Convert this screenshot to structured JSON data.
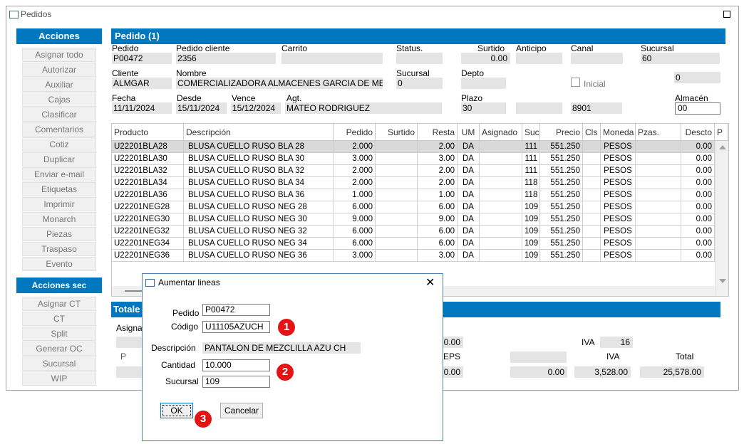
{
  "window": {
    "title": "Pedidos"
  },
  "acciones": {
    "title": "Acciones",
    "items": [
      "Asignar todo",
      "Autorizar",
      "Auxiliar",
      "Cajas",
      "Clasificar",
      "Comentarios",
      "Cotiz",
      "Duplicar",
      "Enviar e-mail",
      "Etiquetas",
      "Imprimir",
      "Monarch",
      "Piezas",
      "Traspaso",
      "Evento"
    ]
  },
  "acciones_sec": {
    "title": "Acciones sec",
    "items": [
      "Asignar CT",
      "CT",
      "Split",
      "Generar OC",
      "Sucursal",
      "WIP"
    ]
  },
  "pedido": {
    "title": "Pedido (1)",
    "labels": {
      "pedido": "Pedido",
      "pedido_cliente": "Pedido cliente",
      "carrito": "Carrito",
      "status": "Status.",
      "surtido": "Surtido",
      "anticipo": "Anticipo",
      "canal": "Canal",
      "sucursal": "Sucursal",
      "cliente": "Cliente",
      "nombre": "Nombre",
      "sucursal2": "Sucursal",
      "depto": "Depto",
      "inicial": "Inicial",
      "fecha": "Fecha",
      "desde": "Desde",
      "vence": "Vence",
      "agt": "Agt.",
      "plazo": "Plazo",
      "almacen": "Almacén"
    },
    "values": {
      "pedido": "P00472",
      "pedido_cliente": "2356",
      "carrito": "",
      "status": "",
      "surtido": "0.00",
      "anticipo": "",
      "canal": "",
      "sucursal": "60",
      "cliente": "ALMGAR",
      "nombre": "COMERCIALIZADORA ALMACENES GARCIA DE MEXIC",
      "sucursal2": "0",
      "depto": "",
      "right_value": "0",
      "fecha": "11/11/2024",
      "desde": "15/11/2024",
      "vence": "15/12/2024",
      "agt": "MATEO RODRIGUEZ",
      "plazo": "30",
      "plazo_extra": "",
      "code": "8901",
      "almacen": "00"
    }
  },
  "grid": {
    "headers": [
      "Producto",
      "Descripción",
      "Pedido",
      "Surtido",
      "Resta",
      "UM",
      "Asignado",
      "Suc.",
      "Precio",
      "Cls",
      "Moneda",
      "Pzas.",
      "Descto",
      "P"
    ],
    "rows": [
      [
        "U22201BLA28",
        "BLUSA CUELLO RUSO BLA 28",
        "2.000",
        "",
        "2.00",
        "DA",
        "",
        "111",
        "551.250",
        "",
        "PESOS",
        "",
        "0.00"
      ],
      [
        "U22201BLA30",
        "BLUSA CUELLO RUSO BLA 30",
        "3.000",
        "",
        "3.00",
        "DA",
        "",
        "111",
        "551.250",
        "",
        "PESOS",
        "",
        "0.00"
      ],
      [
        "U22201BLA32",
        "BLUSA CUELLO RUSO BLA 32",
        "2.000",
        "",
        "2.00",
        "DA",
        "",
        "111",
        "551.250",
        "",
        "PESOS",
        "",
        "0.00"
      ],
      [
        "U22201BLA34",
        "BLUSA CUELLO RUSO BLA 34",
        "2.000",
        "",
        "2.00",
        "DA",
        "",
        "118",
        "551.250",
        "",
        "PESOS",
        "",
        "0.00"
      ],
      [
        "U22201BLA36",
        "BLUSA CUELLO RUSO BLA 36",
        "1.000",
        "",
        "1.00",
        "DA",
        "",
        "118",
        "551.250",
        "",
        "PESOS",
        "",
        "0.00"
      ],
      [
        "U22201NEG28",
        "BLUSA CUELLO RUSO NEG 28",
        "6.000",
        "",
        "6.00",
        "DA",
        "",
        "109",
        "551.250",
        "",
        "PESOS",
        "",
        "0.00"
      ],
      [
        "U22201NEG30",
        "BLUSA CUELLO RUSO NEG 30",
        "9.000",
        "",
        "9.00",
        "DA",
        "",
        "109",
        "551.250",
        "",
        "PESOS",
        "",
        "0.00"
      ],
      [
        "U22201NEG32",
        "BLUSA CUELLO RUSO NEG 32",
        "6.000",
        "",
        "6.00",
        "DA",
        "",
        "109",
        "551.250",
        "",
        "PESOS",
        "",
        "0.00"
      ],
      [
        "U22201NEG34",
        "BLUSA CUELLO RUSO NEG 34",
        "6.000",
        "",
        "6.00",
        "DA",
        "",
        "109",
        "551.250",
        "",
        "PESOS",
        "",
        "0.00"
      ],
      [
        "U22201NEG36",
        "BLUSA CUELLO RUSO NEG 36",
        "3.000",
        "",
        "3.00",
        "DA",
        "",
        "109",
        "551.250",
        "",
        "PESOS",
        "",
        "0.00"
      ]
    ]
  },
  "totales": {
    "title": "Totale",
    "asigna": "Asigna",
    "iva_label": "IVA",
    "iva_rate": "16",
    "val_00": "0.00",
    "eps_label": "EPS",
    "eps_value": "0.00",
    "blank_value": "0.00",
    "iva2_label": "IVA",
    "iva_value": "3,528.00",
    "total_label": "Total",
    "total_value": "25,578.00"
  },
  "dialog": {
    "title": "Aumentar lineas",
    "labels": {
      "pedido": "Pedido",
      "codigo": "Código",
      "descripcion": "Descripción",
      "cantidad": "Cantidad",
      "sucursal": "Sucursal"
    },
    "values": {
      "pedido": "P00472",
      "codigo": "U11105AZUCH",
      "descripcion": "PANTALON DE MEZCLILLA AZU CH",
      "cantidad": "10.000",
      "sucursal": "109"
    },
    "ok": "OK",
    "cancel": "Cancelar"
  },
  "badges": [
    "1",
    "2",
    "3"
  ]
}
